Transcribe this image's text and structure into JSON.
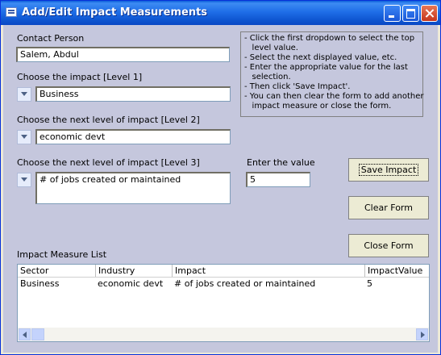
{
  "window": {
    "title": "Add/Edit Impact Measurements"
  },
  "form": {
    "contact_label": "Contact Person",
    "contact_value": "Salem, Abdul",
    "level1_label": "Choose the impact [Level 1]",
    "level1_value": "Business",
    "level2_label": "Choose the next level of impact [Level 2]",
    "level2_value": "economic devt",
    "level3_label": "Choose the next level of impact [Level 3]",
    "level3_value": "# of jobs created or maintained",
    "value_label": "Enter the value",
    "value_value": "5"
  },
  "instructions": [
    "- Click the first dropdown to select the top",
    "   level value.",
    "- Select the next displayed value, etc.",
    "- Enter the appropriate value for the last",
    "   selection.",
    "- Then click 'Save Impact'.",
    "- You can then clear the form to add another",
    "   impact measure or close the form."
  ],
  "buttons": {
    "save": "Save Impact",
    "clear": "Clear Form",
    "close": "Close Form"
  },
  "list": {
    "label": "Impact Measure List",
    "columns": [
      "Sector",
      "Industry",
      "Impact",
      "ImpactValue"
    ],
    "rows": [
      [
        "Business",
        "economic devt",
        "# of jobs created or maintained",
        "5"
      ]
    ]
  }
}
